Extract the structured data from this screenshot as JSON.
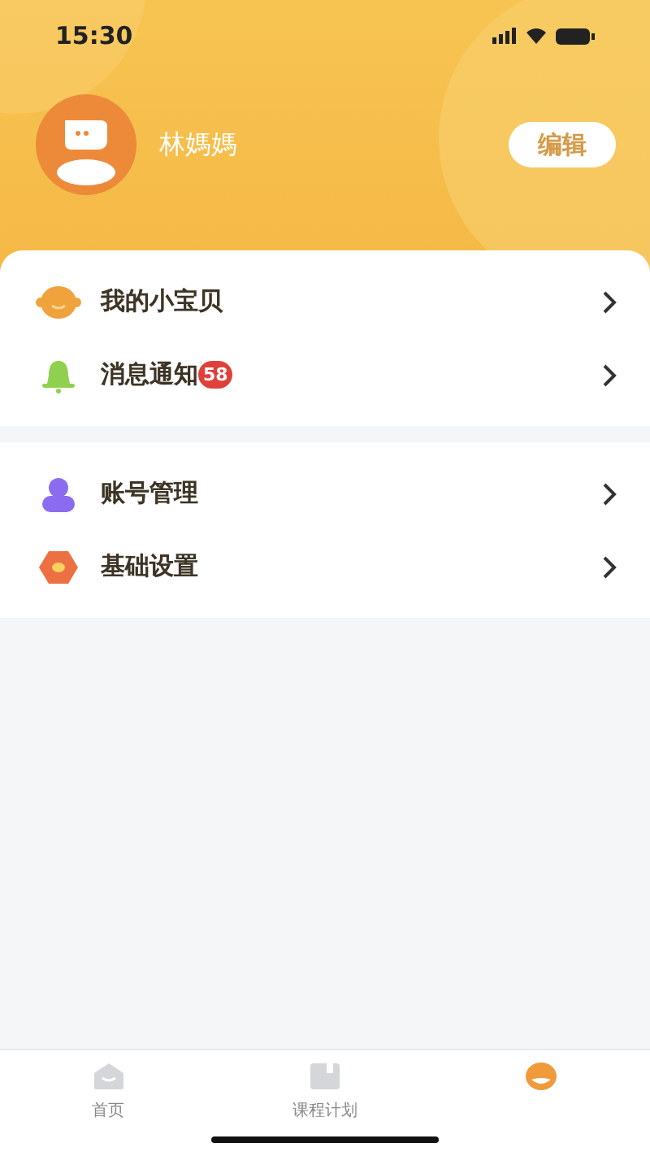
{
  "status_bar": {
    "time": "15:30"
  },
  "profile": {
    "name": "林媽媽",
    "edit_button": "编辑"
  },
  "menu_groups": [
    {
      "items": [
        {
          "kind": "baby",
          "label": "我的小宝贝"
        },
        {
          "kind": "bell",
          "label": "消息通知",
          "badge": "58"
        }
      ]
    },
    {
      "items": [
        {
          "kind": "account",
          "label": "账号管理"
        },
        {
          "kind": "settings",
          "label": "基础设置"
        }
      ]
    }
  ],
  "tabs": [
    {
      "kind": "home",
      "label": "首页",
      "selected": false
    },
    {
      "kind": "plan",
      "label": "课程计划",
      "selected": false
    },
    {
      "kind": "me",
      "selected": true
    }
  ]
}
